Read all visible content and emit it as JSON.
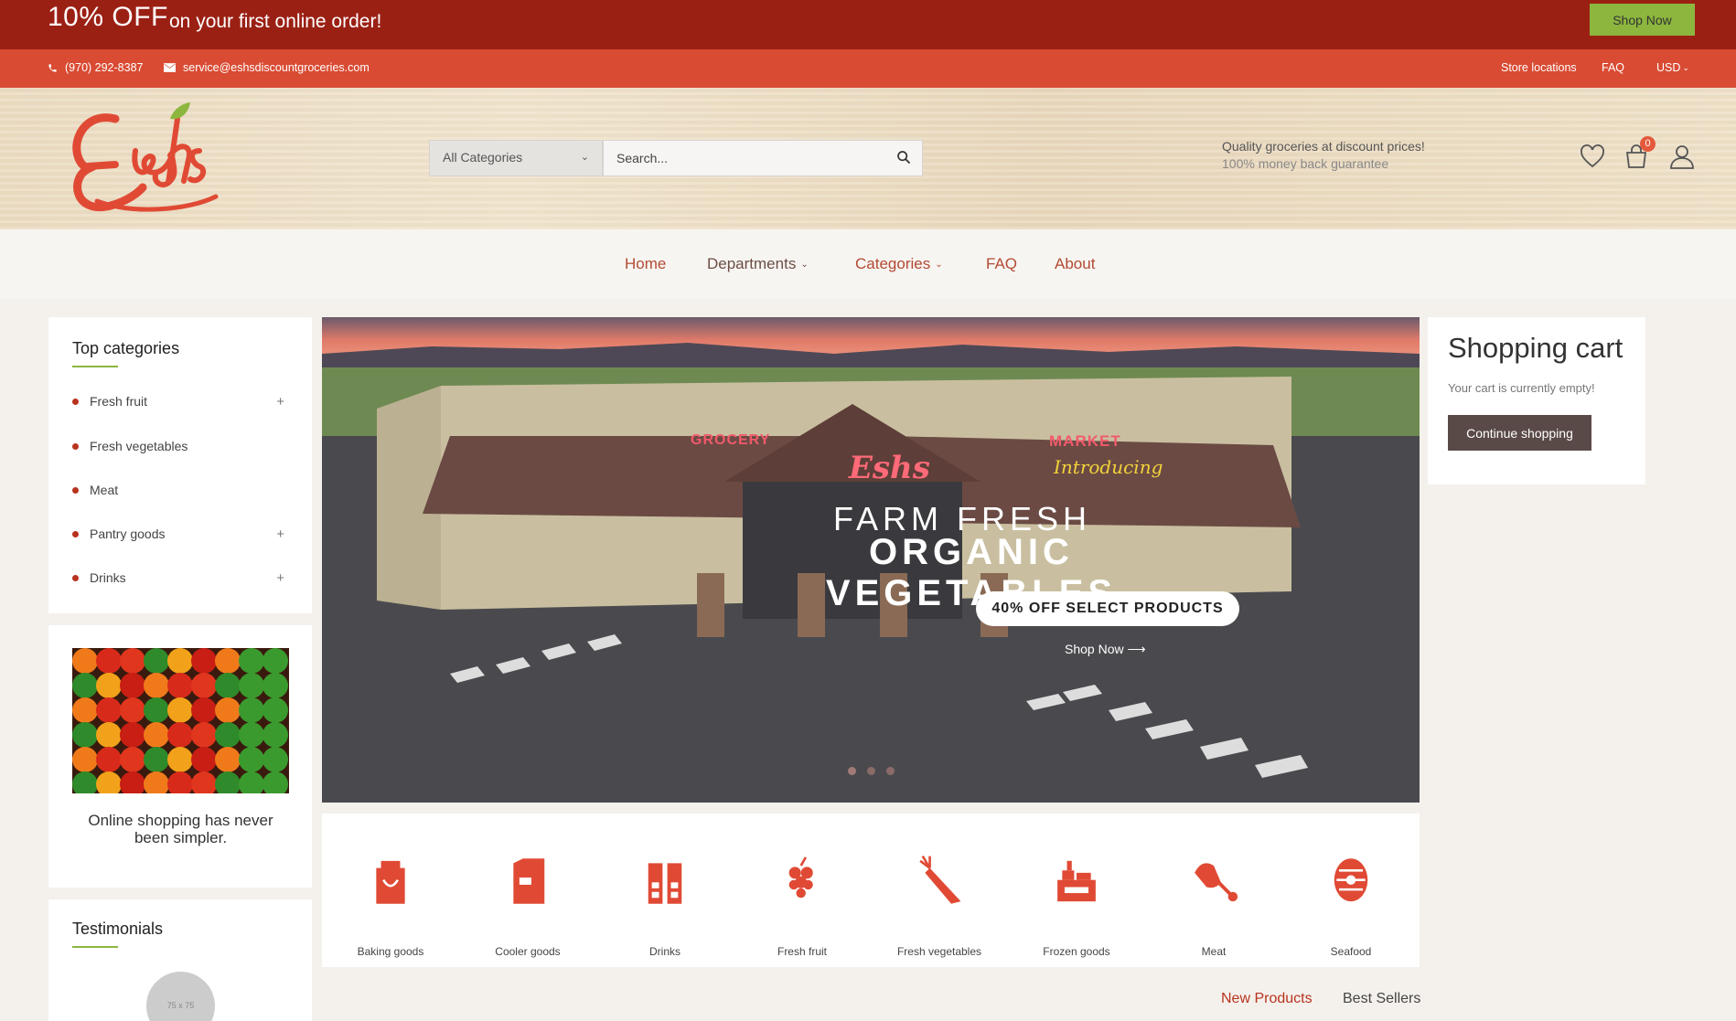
{
  "promo": {
    "big": "10% OFF",
    "small": "on your first online order!",
    "shop_label": "Shop Now"
  },
  "topbar": {
    "phone": "(970) 292-8387",
    "email": "service@eshsdiscountgroceries.com",
    "store_locations": "Store locations",
    "faq": "FAQ",
    "currency": "USD"
  },
  "header": {
    "category_select": "All Categories",
    "search_placeholder": "Search...",
    "tagline1": "Quality groceries at discount prices!",
    "tagline2": "100% money back guarantee",
    "cart_count": "0",
    "logo_text": "Eshs"
  },
  "nav": [
    "Home",
    "Departments",
    "Categories",
    "FAQ",
    "About"
  ],
  "sidebar": {
    "title": "Top categories",
    "items": [
      {
        "label": "Fresh fruit",
        "expand": "+"
      },
      {
        "label": "Fresh vegetables",
        "expand": ""
      },
      {
        "label": "Meat",
        "expand": ""
      },
      {
        "label": "Pantry goods",
        "expand": "+"
      },
      {
        "label": "Drinks",
        "expand": "+"
      }
    ],
    "banner_caption": "Online shopping has never been simpler.",
    "testimonials_title": "Testimonials",
    "avatar_placeholder": "75 x 75"
  },
  "slider": {
    "line1": "FARM FRESH",
    "line2": "ORGANIC VEGETABLES",
    "cta": "40% OFF SELECT PRODUCTS",
    "shop": "Shop Now",
    "sign_grocery": "GROCERY",
    "sign_market": "MARKET",
    "sign_introducing": "Introducing",
    "sign_logo": "Eshs",
    "active_dot": 0,
    "dot_count": 3
  },
  "categories": [
    {
      "label": "Baking goods",
      "icon": "baking-goods-icon"
    },
    {
      "label": "Cooler goods",
      "icon": "cooler-goods-icon"
    },
    {
      "label": "Drinks",
      "icon": "drinks-icon"
    },
    {
      "label": "Fresh fruit",
      "icon": "fresh-fruit-icon"
    },
    {
      "label": "Fresh vegetables",
      "icon": "fresh-vegetables-icon"
    },
    {
      "label": "Frozen goods",
      "icon": "frozen-goods-icon"
    },
    {
      "label": "Meat",
      "icon": "meat-icon"
    },
    {
      "label": "Seafood",
      "icon": "seafood-icon"
    }
  ],
  "cart": {
    "title": "Shopping cart",
    "empty": "Your cart is currently empty!",
    "continue": "Continue shopping"
  },
  "product_tabs": [
    "New Products",
    "Best Sellers"
  ],
  "colors": {
    "promo": "#9b2014",
    "topbar": "#d94b33",
    "accent": "#8cb63e",
    "icon": "#e45a3c"
  }
}
